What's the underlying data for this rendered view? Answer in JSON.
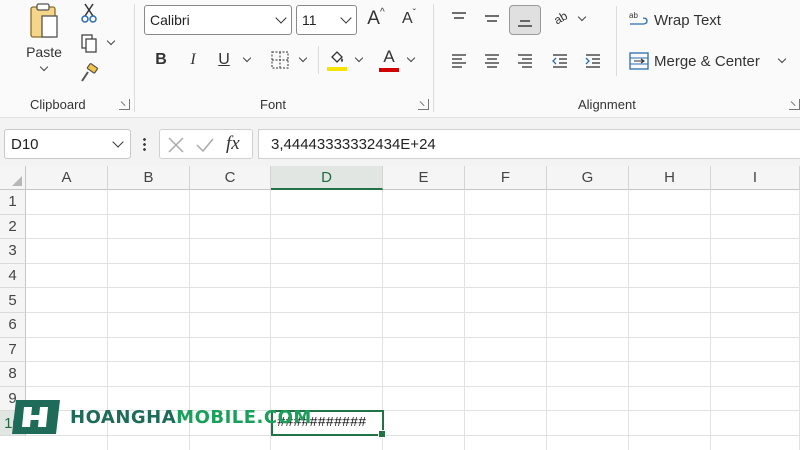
{
  "ribbon": {
    "clipboard": {
      "label": "Clipboard",
      "paste_label": "Paste"
    },
    "font": {
      "label": "Font",
      "font_name": "Calibri",
      "font_size": "11",
      "bold": "B",
      "italic": "I",
      "underline": "U",
      "grow_glyph": "A",
      "shrink_glyph": "A",
      "font_color_glyph": "A",
      "fill_color": "#f5e400",
      "font_color": "#d00000"
    },
    "alignment": {
      "label": "Alignment",
      "wrap_text": "Wrap Text",
      "merge_center": "Merge & Center",
      "orientation_glyph": "ab"
    }
  },
  "formula_bar": {
    "name_box": "D10",
    "fx": "fx",
    "formula": "3,44443333332434E+24"
  },
  "grid": {
    "columns": [
      "A",
      "B",
      "C",
      "D",
      "E",
      "F",
      "G",
      "H",
      "I"
    ],
    "rows": [
      "1",
      "2",
      "3",
      "4",
      "5",
      "6",
      "7",
      "8",
      "9",
      "10"
    ],
    "selected_column": "D",
    "selected_row": "10",
    "active_cell_value": "###########"
  },
  "watermark": {
    "brand_main": "HOANGHA",
    "brand_accent": "MOBILE.COM"
  },
  "colors": {
    "accent_green": "#217346"
  }
}
